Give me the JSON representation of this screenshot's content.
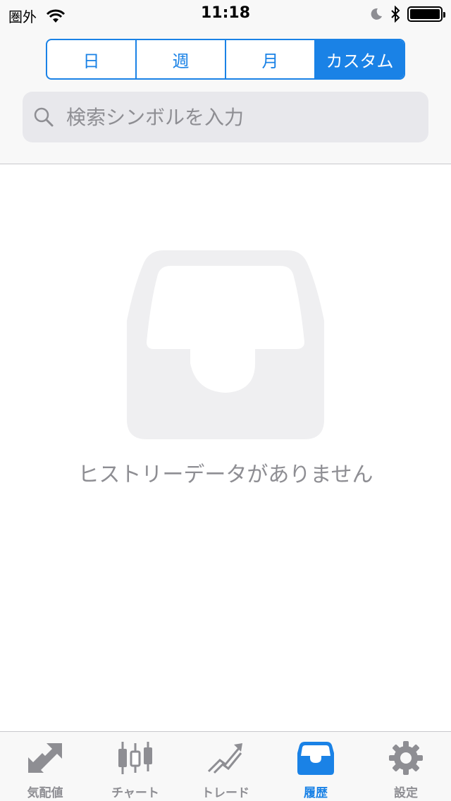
{
  "status_bar": {
    "carrier": "圏外",
    "time": "11:18"
  },
  "segments": [
    {
      "label": "日",
      "active": false
    },
    {
      "label": "週",
      "active": false
    },
    {
      "label": "月",
      "active": false
    },
    {
      "label": "カスタム",
      "active": true
    }
  ],
  "search": {
    "placeholder": "検索シンボルを入力"
  },
  "empty_state": {
    "message": "ヒストリーデータがありません",
    "icon": "empty-tray-icon"
  },
  "tabs": [
    {
      "label": "気配値",
      "icon": "quotes-arrows-icon",
      "active": false
    },
    {
      "label": "チャート",
      "icon": "candlestick-chart-icon",
      "active": false
    },
    {
      "label": "トレード",
      "icon": "trade-trend-icon",
      "active": false
    },
    {
      "label": "履歴",
      "icon": "history-tray-icon",
      "active": true
    },
    {
      "label": "設定",
      "icon": "settings-gear-icon",
      "active": false
    }
  ],
  "colors": {
    "accent": "#1a82e6",
    "inactive": "#8e8e93",
    "empty_icon": "#efeff1"
  }
}
